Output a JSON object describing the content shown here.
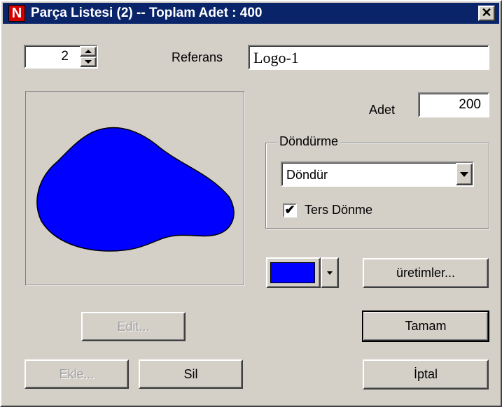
{
  "window": {
    "title": "Parça Listesi (2) -- Toplam Adet : 400",
    "app_icon_letter": "N",
    "close_glyph": "✕"
  },
  "index_spinner": {
    "value": "2"
  },
  "reference": {
    "label": "Referans",
    "value": "Logo-1"
  },
  "quantity": {
    "label": "Adet",
    "value": "200"
  },
  "rotation_group": {
    "title": "Döndürme",
    "select_value": "Döndür",
    "reverse_label": "Ters Dönme",
    "reverse_checked": true,
    "check_glyph": "✔"
  },
  "preview": {
    "shape_color": "#0000ff"
  },
  "color_picker": {
    "color": "#0000ff"
  },
  "buttons": {
    "edit": "Edit...",
    "add": "Ekle...",
    "delete": "Sil",
    "productions": "üretimler...",
    "ok": "Tamam",
    "cancel": "İptal"
  }
}
